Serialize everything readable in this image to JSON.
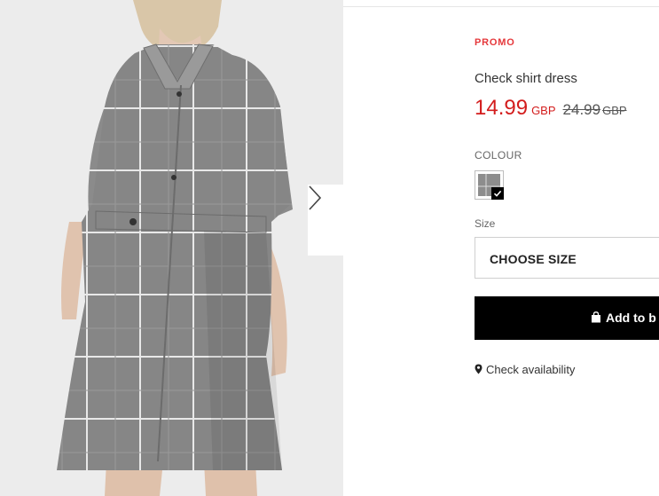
{
  "product": {
    "badge": "PROMO",
    "name": "Check shirt dress",
    "price": {
      "current_amount": "14.99",
      "current_currency": "GBP",
      "old_amount": "24.99",
      "old_currency": "GBP"
    },
    "colour": {
      "label": "COLOUR",
      "selected_swatch": "grey check"
    },
    "size": {
      "label": "Size",
      "placeholder": "CHOOSE SIZE"
    },
    "add_to_bag_label": "Add to b",
    "check_availability_label": "Check availability"
  },
  "gallery": {
    "next_arrow_icon": "chevron-right-icon",
    "image_alt": "Model wearing grey check shirt dress"
  },
  "colors": {
    "promo_red": "#e5383b",
    "price_red": "#d31d1d",
    "button_black": "#000000"
  }
}
